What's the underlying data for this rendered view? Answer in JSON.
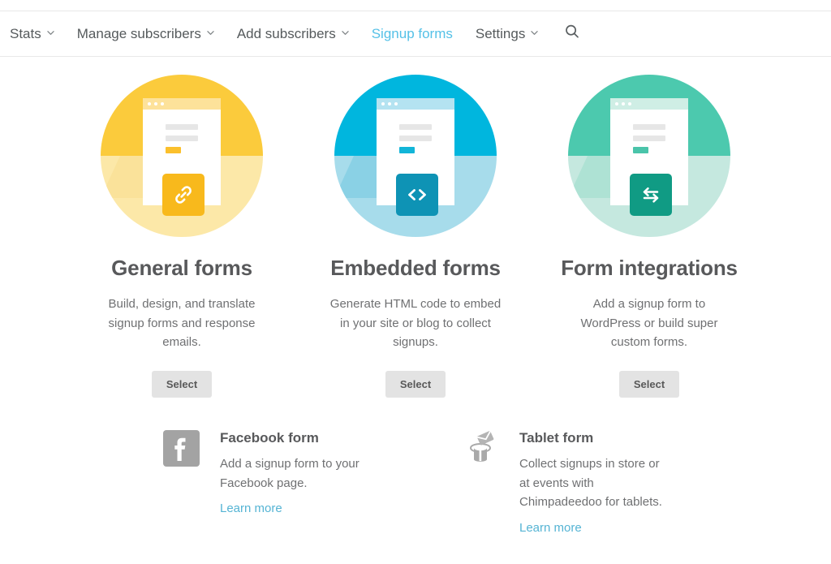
{
  "nav": {
    "items": [
      {
        "label": "Stats",
        "has_caret": true,
        "active": false
      },
      {
        "label": "Manage subscribers",
        "has_caret": true,
        "active": false
      },
      {
        "label": "Add subscribers",
        "has_caret": true,
        "active": false
      },
      {
        "label": "Signup forms",
        "has_caret": false,
        "active": true
      },
      {
        "label": "Settings",
        "has_caret": true,
        "active": false
      }
    ],
    "search_icon": "search-icon",
    "active_color": "#55c1e7",
    "text_color": "#555a5c"
  },
  "cards": [
    {
      "id": "general-forms",
      "title": "General forms",
      "description": "Build, design, and translate signup forms and response emails.",
      "button_label": "Select",
      "badge_icon": "link-icon",
      "colors": {
        "circle_top": "#fbcb3c",
        "circle_bottom": "#fce8a8",
        "shadow": "#f7dd8e",
        "titlebar": "#fde29a",
        "accent_bar": "#fbc02c",
        "badge": "#f8b91c"
      }
    },
    {
      "id": "embedded-forms",
      "title": "Embedded forms",
      "description": "Generate HTML code to embed in your site or blog to collect signups.",
      "button_label": "Select",
      "badge_icon": "code-icon",
      "colors": {
        "circle_top": "#00b6de",
        "circle_bottom": "#a7dceb",
        "shadow": "#73c8e0",
        "titlebar": "#b4e3f1",
        "accent_bar": "#12b5d8",
        "badge": "#0e93b5"
      }
    },
    {
      "id": "form-integrations",
      "title": "Form integrations",
      "description": "Add a signup form to WordPress or build super custom forms.",
      "button_label": "Select",
      "badge_icon": "exchange-arrows-icon",
      "colors": {
        "circle_top": "#4cc9ae",
        "circle_bottom": "#c5e8df",
        "shadow": "#9adccb",
        "titlebar": "#cfeee5",
        "accent_bar": "#4ac4aa",
        "badge": "#109b84"
      }
    }
  ],
  "minis": [
    {
      "id": "facebook-form",
      "icon": "facebook-icon",
      "title": "Facebook form",
      "description": "Add a signup form to your Facebook page.",
      "link_label": "Learn more"
    },
    {
      "id": "tablet-form",
      "icon": "magic-hat-envelope-icon",
      "title": "Tablet form",
      "description": "Collect signups in store or at events with Chimpadeedoo for tablets.",
      "link_label": "Learn more"
    }
  ],
  "link_color": "#55b4d4"
}
